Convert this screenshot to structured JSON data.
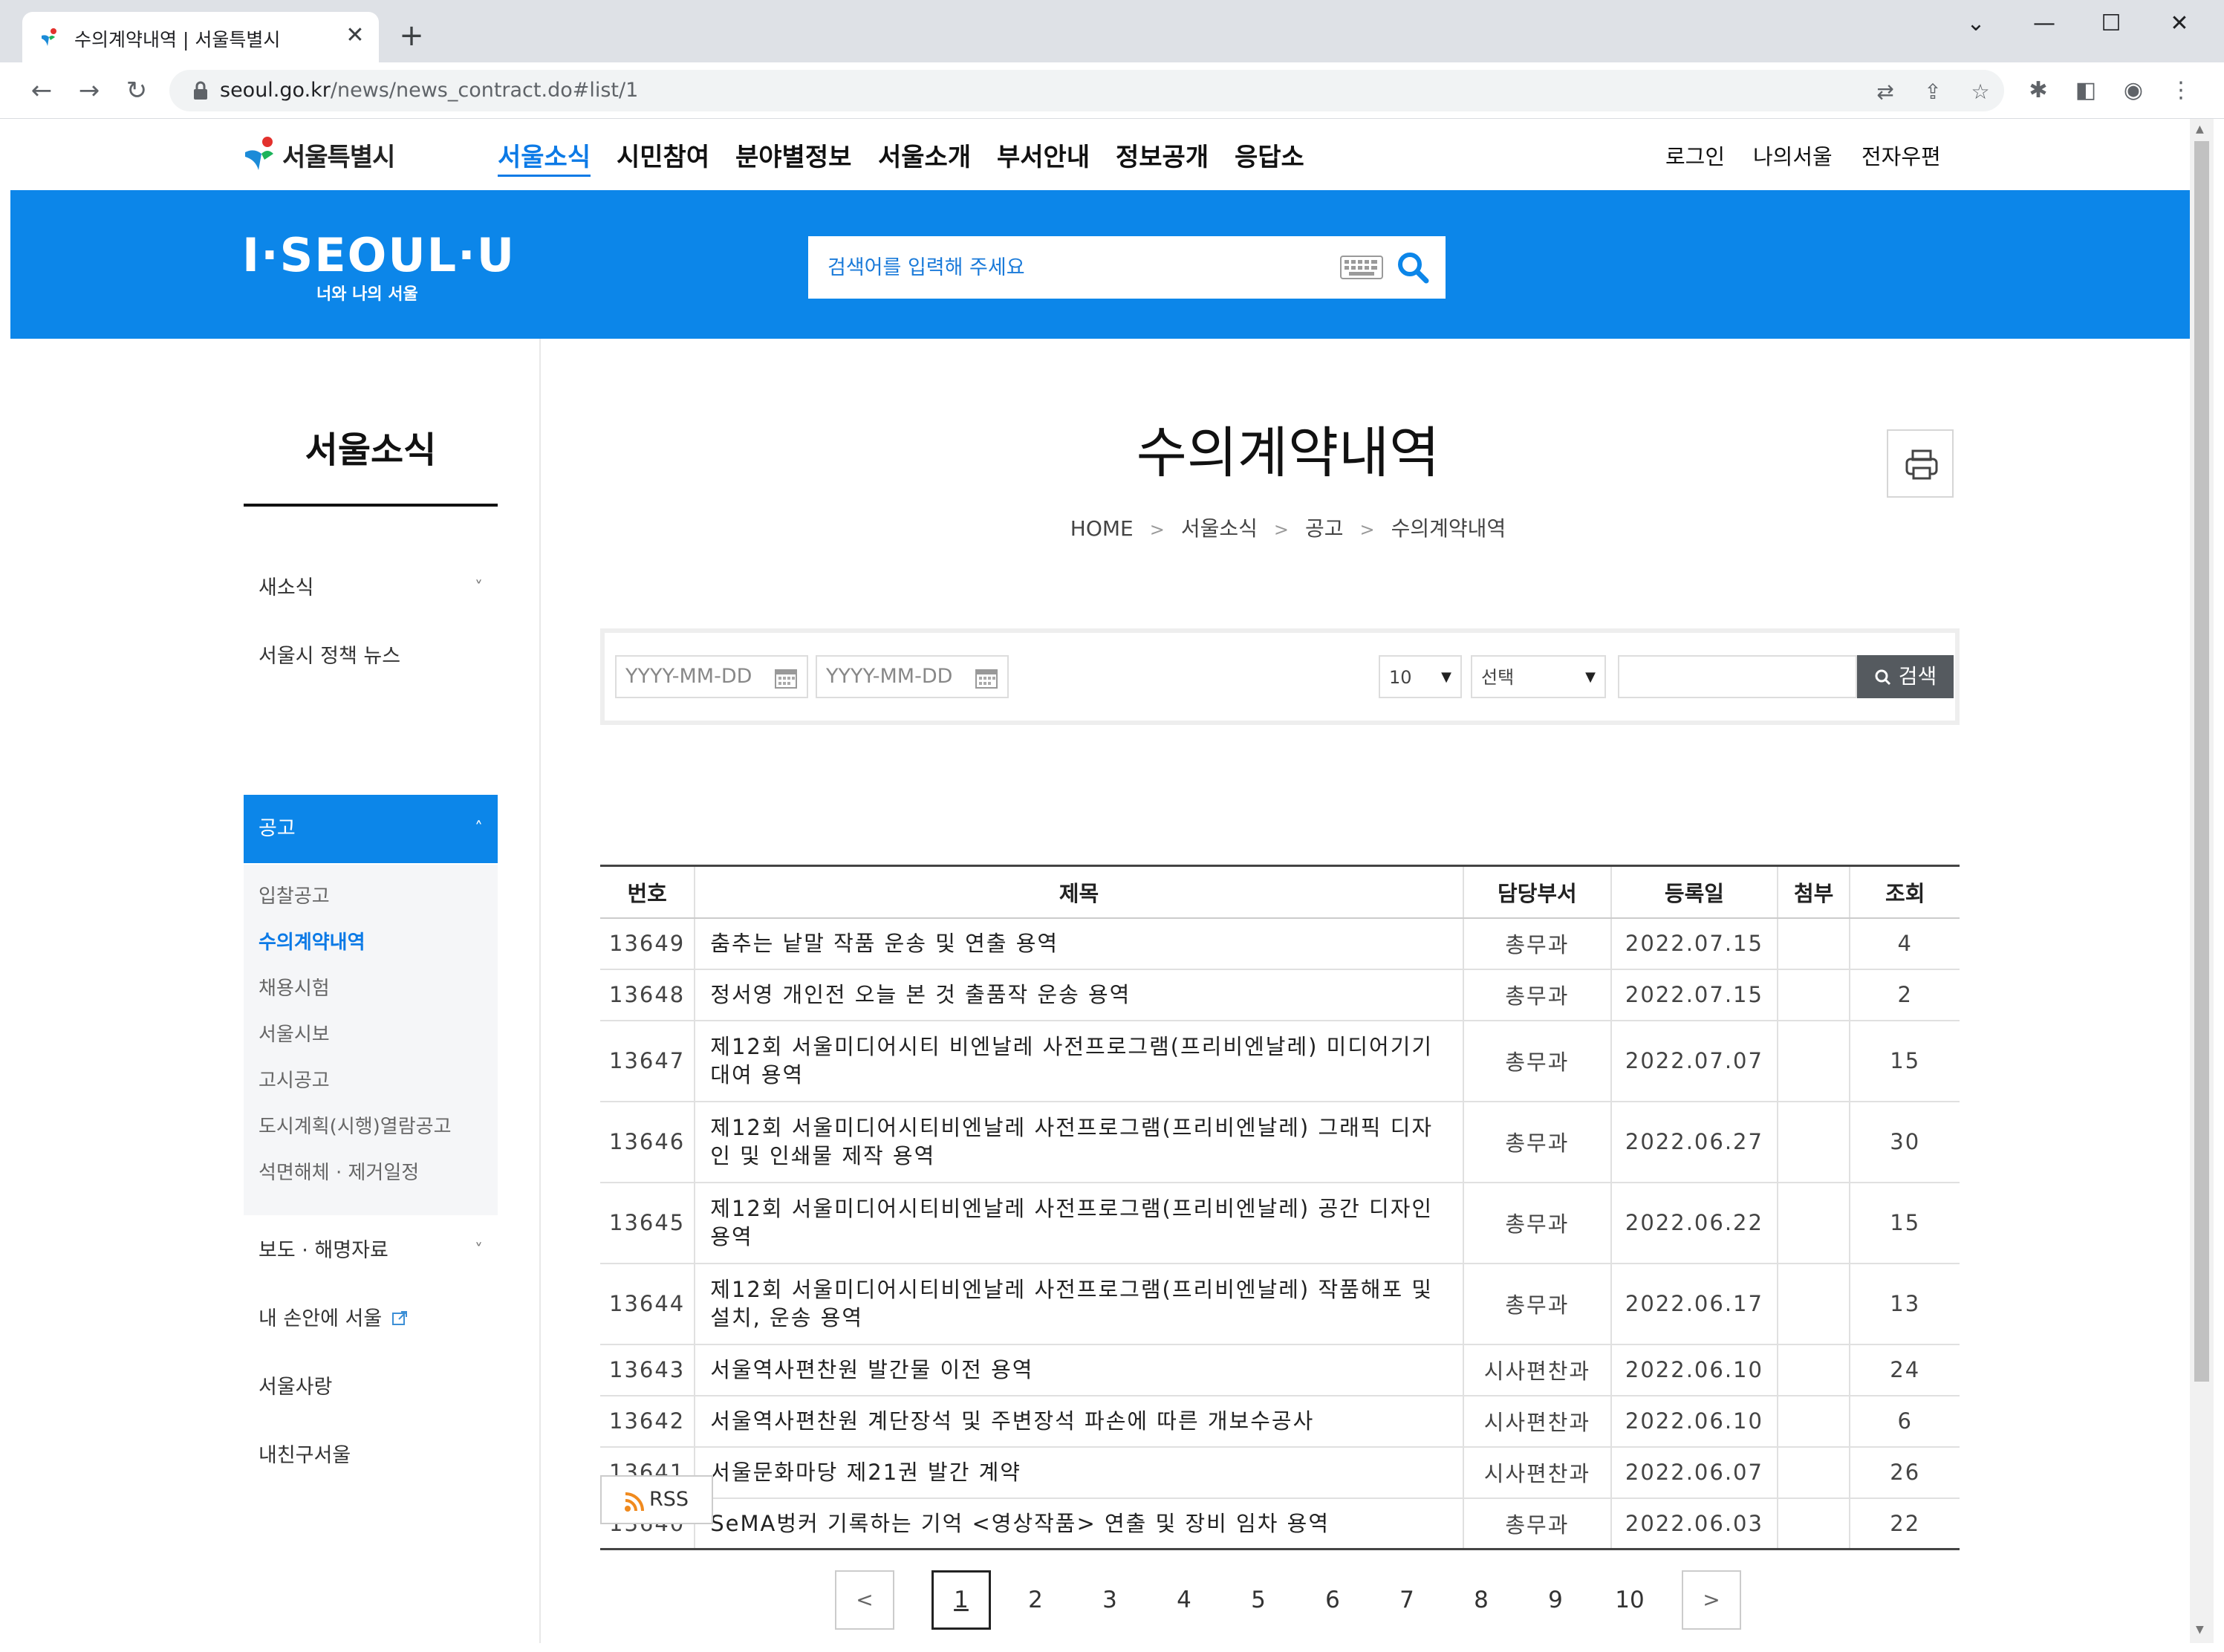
{
  "browser": {
    "tab_title": "수의계약내역 | 서울특별시",
    "url_domain": "seoul.go.kr",
    "url_path": "/news/news_contract.do#list/1"
  },
  "site": {
    "logo_text": "서울특별시",
    "gnb": [
      "서울소식",
      "시민참여",
      "분야별정보",
      "서울소개",
      "부서안내",
      "정보공개",
      "응답소"
    ],
    "util": [
      "로그인",
      "나의서울",
      "전자우편"
    ],
    "brand_main": "I·SEOUL·U",
    "brand_sub": "너와 나의 서울",
    "search_placeholder": "검색어를 입력해 주세요",
    "accent_color": "#0c86e9"
  },
  "lnb": {
    "title": "서울소식",
    "items": [
      {
        "label": "새소식",
        "chevron": "˅"
      },
      {
        "label": "서울시 정책 뉴스"
      },
      {
        "label": "공고",
        "chevron": "˄"
      },
      {
        "label": "보도 · 해명자료",
        "chevron": "˅"
      },
      {
        "label": "내 손안에 서울"
      },
      {
        "label": "서울사랑"
      },
      {
        "label": "내친구서울"
      }
    ],
    "sub_items": [
      "입찰공고",
      "수의계약내역",
      "채용시험",
      "서울시보",
      "고시공고",
      "도시계획(시행)열람공고",
      "석면해체 · 제거일정"
    ]
  },
  "content": {
    "title": "수의계약내역",
    "breadcrumb": [
      "HOME",
      "서울소식",
      "공고",
      "수의계약내역"
    ],
    "breadcrumb_sep": ">",
    "filter": {
      "date_placeholder": "YYYY-MM-DD",
      "date_sep": "-",
      "page_size": "10",
      "field_select": "선택",
      "search_label": "검색"
    },
    "table": {
      "headers": [
        "번호",
        "제목",
        "담당부서",
        "등록일",
        "첨부",
        "조회"
      ],
      "rows": [
        {
          "no": "13649",
          "title": "춤추는 낱말 작품 운송 및 연출 용역",
          "dept": "총무과",
          "date": "2022.07.15",
          "att": "",
          "views": "4"
        },
        {
          "no": "13648",
          "title": "정서영 개인전 오늘 본 것 출품작 운송 용역",
          "dept": "총무과",
          "date": "2022.07.15",
          "att": "",
          "views": "2"
        },
        {
          "no": "13647",
          "title": "제12회 서울미디어시티 비엔날레 사전프로그램(프리비엔날레) 미디어기기 대여 용역",
          "dept": "총무과",
          "date": "2022.07.07",
          "att": "",
          "views": "15"
        },
        {
          "no": "13646",
          "title": "제12회 서울미디어시티비엔날레 사전프로그램(프리비엔날레) 그래픽 디자인 및 인쇄물 제작 용역",
          "dept": "총무과",
          "date": "2022.06.27",
          "att": "",
          "views": "30"
        },
        {
          "no": "13645",
          "title": "제12회 서울미디어시티비엔날레 사전프로그램(프리비엔날레) 공간 디자인 용역",
          "dept": "총무과",
          "date": "2022.06.22",
          "att": "",
          "views": "15"
        },
        {
          "no": "13644",
          "title": "제12회 서울미디어시티비엔날레 사전프로그램(프리비엔날레) 작품해포 및 설치, 운송 용역",
          "dept": "총무과",
          "date": "2022.06.17",
          "att": "",
          "views": "13"
        },
        {
          "no": "13643",
          "title": "서울역사편찬원 발간물 이전 용역",
          "dept": "시사편찬과",
          "date": "2022.06.10",
          "att": "",
          "views": "24"
        },
        {
          "no": "13642",
          "title": "서울역사편찬원 계단장석 및 주변장석 파손에 따른 개보수공사",
          "dept": "시사편찬과",
          "date": "2022.06.10",
          "att": "",
          "views": "6"
        },
        {
          "no": "13641",
          "title": "서울문화마당 제21권 발간 계약",
          "dept": "시사편찬과",
          "date": "2022.06.07",
          "att": "",
          "views": "26"
        },
        {
          "no": "13640",
          "title": "SeMA벙커 기록하는 기억 <영상작품> 연출 및 장비 임차 용역",
          "dept": "총무과",
          "date": "2022.06.03",
          "att": "",
          "views": "22"
        }
      ]
    },
    "rss_label": "RSS",
    "pager": {
      "prev": "<",
      "next": ">",
      "pages": [
        "1",
        "2",
        "3",
        "4",
        "5",
        "6",
        "7",
        "8",
        "9",
        "10"
      ],
      "current": "1"
    }
  }
}
